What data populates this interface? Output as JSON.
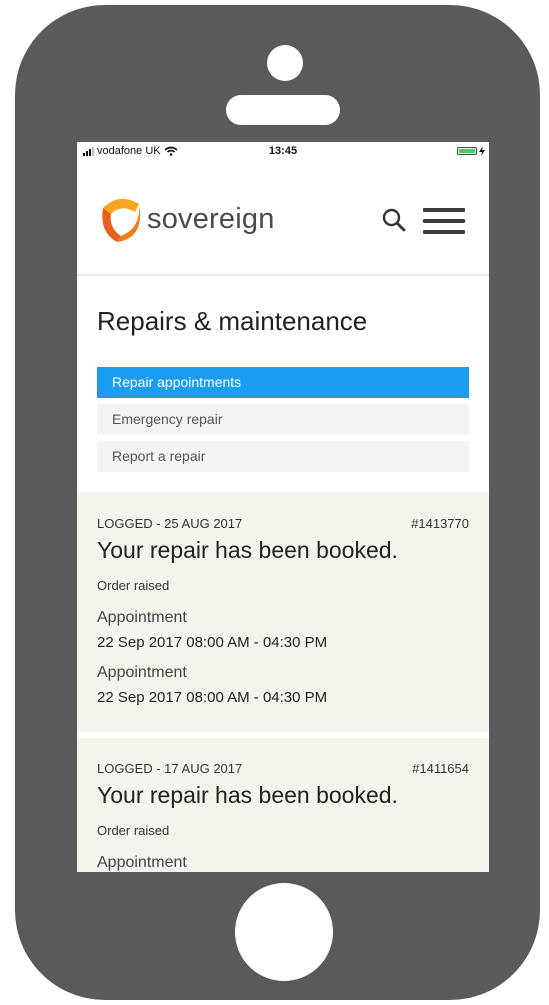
{
  "status_bar": {
    "carrier": "vodafone UK",
    "time": "13:45"
  },
  "header": {
    "logo_text": "sovereign",
    "brand_color": "#f07d1a"
  },
  "page": {
    "title": "Repairs & maintenance"
  },
  "subnav": {
    "items": [
      {
        "label": "Repair appointments",
        "active": true
      },
      {
        "label": "Emergency repair",
        "active": false
      },
      {
        "label": "Report a repair",
        "active": false
      }
    ]
  },
  "repairs": [
    {
      "logged": "LOGGED - 25 AUG 2017",
      "number": "#1413770",
      "title": "Your repair has been booked.",
      "status": "Order raised",
      "appointments": [
        {
          "label": "Appointment",
          "value": "22 Sep 2017 08:00 AM - 04:30 PM"
        },
        {
          "label": "Appointment",
          "value": "22 Sep 2017 08:00 AM - 04:30 PM"
        }
      ]
    },
    {
      "logged": "LOGGED - 17 AUG 2017",
      "number": "#1411654",
      "title": "Your repair has been booked.",
      "status": "Order raised",
      "appointments": [
        {
          "label": "Appointment"
        }
      ]
    }
  ],
  "colors": {
    "active_tab": "#1a9cf2",
    "card_background": "#f3f4eb",
    "phone_frame": "#5a5a5c"
  }
}
